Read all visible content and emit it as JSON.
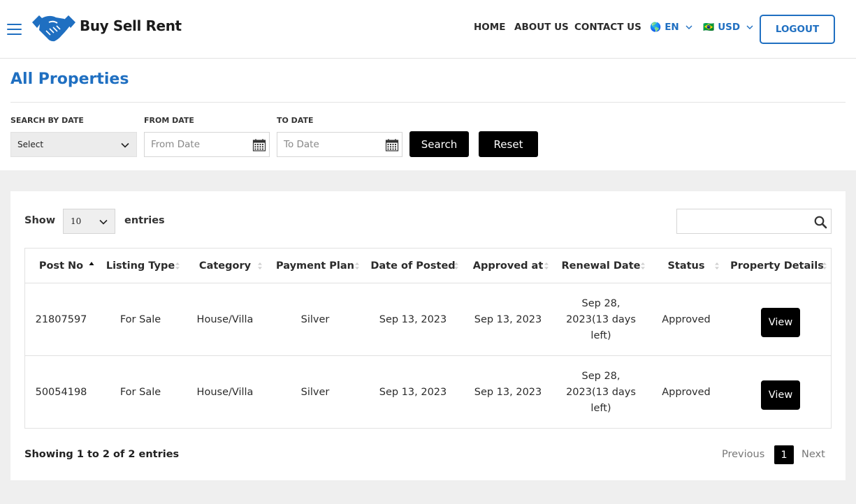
{
  "header": {
    "logo_text": "Buy Sell Rent",
    "nav": [
      "HOME",
      "ABOUT US",
      "CONTACT US"
    ],
    "language": "EN",
    "language_flag": "🌎",
    "currency": "USD",
    "currency_flag": "🇧🇷",
    "logout_label": "LOGOUT"
  },
  "page": {
    "title": "All Properties"
  },
  "filters": {
    "search_by_date_label": "SEARCH BY DATE",
    "search_by_date_value": "Select",
    "from_date_label": "FROM DATE",
    "from_date_placeholder": "From Date",
    "to_date_label": "TO DATE",
    "to_date_placeholder": "To Date",
    "search_label": "Search",
    "reset_label": "Reset"
  },
  "table_controls": {
    "show_label": "Show",
    "entries_value": "10",
    "entries_label": "entries",
    "search_value": ""
  },
  "table": {
    "columns": [
      "Post No",
      "Listing Type",
      "Category",
      "Payment Plan",
      "Date of Posted",
      "Approved at",
      "Renewal Date",
      "Status",
      "Property Details"
    ],
    "rows": [
      {
        "post_no": "21807597",
        "listing_type": "For Sale",
        "category": "House/Villa",
        "payment_plan": "Silver",
        "date_posted": "Sep 13, 2023",
        "approved_at": "Sep 13, 2023",
        "renewal_date": "Sep 28, 2023(13 days left)",
        "status": "Approved",
        "action": "View"
      },
      {
        "post_no": "50054198",
        "listing_type": "For Sale",
        "category": "House/Villa",
        "payment_plan": "Silver",
        "date_posted": "Sep 13, 2023",
        "approved_at": "Sep 13, 2023",
        "renewal_date": "Sep 28, 2023(13 days left)",
        "status": "Approved",
        "action": "View"
      }
    ]
  },
  "footer": {
    "showing_text": "Showing 1 to 2 of 2 entries",
    "previous_label": "Previous",
    "current_page": "1",
    "next_label": "Next"
  },
  "colors": {
    "brand_blue": "#1f6fc1",
    "button_black": "#000000",
    "panel_gray": "#efefef"
  },
  "icons": [
    "hamburger-menu-icon",
    "handshake-logo-icon",
    "chevron-down-icon",
    "calendar-icon",
    "search-icon",
    "sort-icon"
  ]
}
